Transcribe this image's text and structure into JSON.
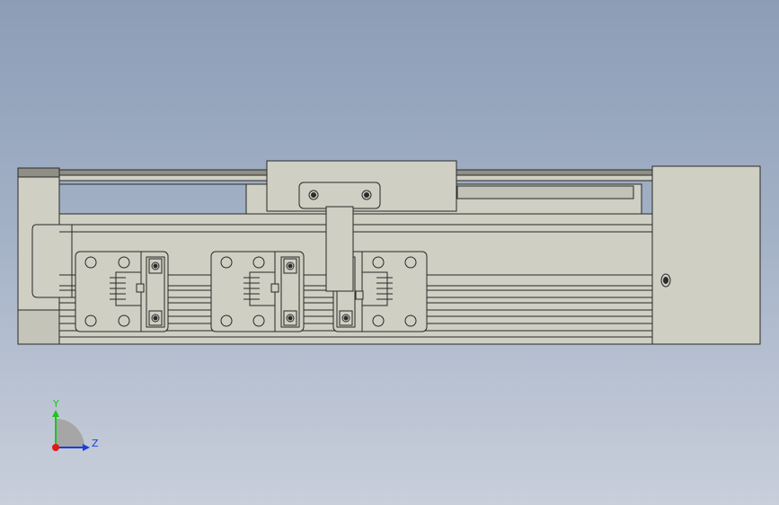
{
  "viewport": {
    "background_top": "#8c9db6",
    "background_bottom": "#c9cfdb",
    "model_fill": "#cfcfc3",
    "model_stroke": "#2a2a2a",
    "model_shade": "#b9b9ad"
  },
  "triad": {
    "y_label": "Y",
    "z_label": "Z",
    "y_color": "#1fc41f",
    "z_color": "#1a3fe0",
    "x_color": "#e01a1a"
  }
}
